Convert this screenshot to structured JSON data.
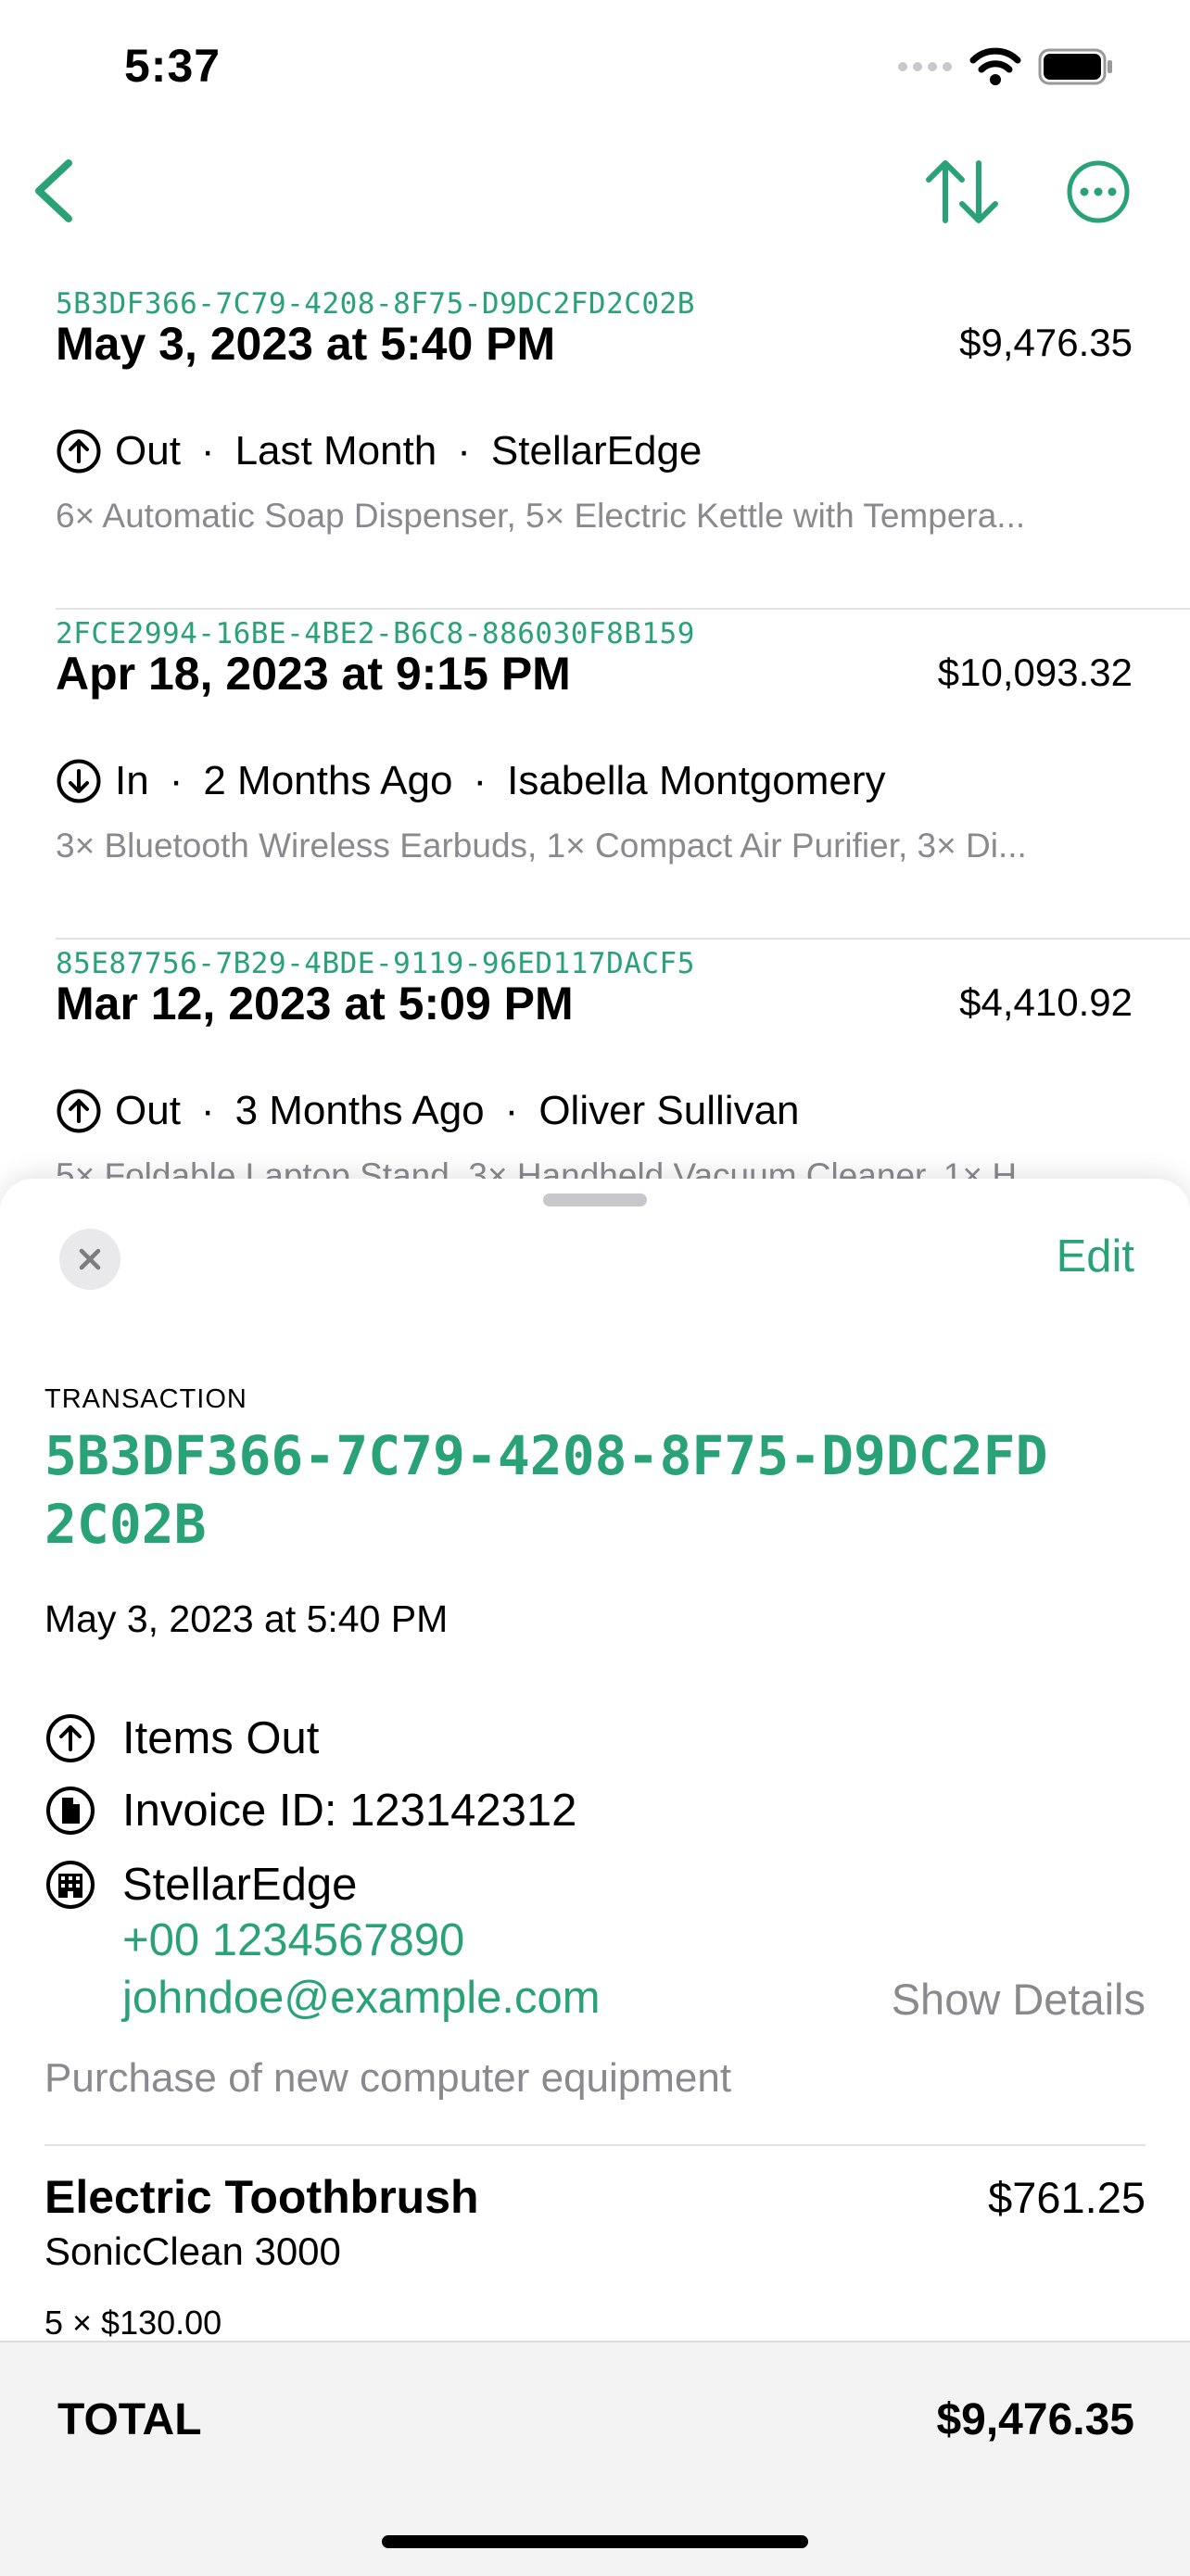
{
  "status_bar": {
    "time": "5:37"
  },
  "theme": {
    "accent": "#2aa277",
    "secondary_text": "#8a8a8e"
  },
  "nav": {
    "back_icon": "chevron-left-icon",
    "sort_icon": "arrow-up-down-icon",
    "more_icon": "ellipsis-circle-icon"
  },
  "transactions": [
    {
      "id": "5B3DF366-7C79-4208-8F75-D9DC2FD2C02B",
      "date": "May 3, 2023 at 5:40 PM",
      "amount": "$9,476.35",
      "direction": "Out",
      "direction_icon": "arrow-up-circle-icon",
      "relative": "Last Month",
      "party": "StellarEdge",
      "items": "6× Automatic Soap Dispenser, 5× Electric Kettle with Tempera..."
    },
    {
      "id": "2FCE2994-16BE-4BE2-B6C8-886030F8B159",
      "date": "Apr 18, 2023 at 9:15 PM",
      "amount": "$10,093.32",
      "direction": "In",
      "direction_icon": "arrow-down-circle-icon",
      "relative": "2 Months Ago",
      "party": "Isabella Montgomery",
      "items": "3× Bluetooth Wireless Earbuds, 1× Compact Air Purifier, 3× Di..."
    },
    {
      "id": "85E87756-7B29-4BDE-9119-96ED117DACF5",
      "date": "Mar 12, 2023 at 5:09 PM",
      "amount": "$4,410.92",
      "direction": "Out",
      "direction_icon": "arrow-up-circle-icon",
      "relative": "3 Months Ago",
      "party": "Oliver Sullivan",
      "items": "5× Foldable Laptop Stand, 3× Handheld Vacuum Cleaner, 1× H..."
    }
  ],
  "sheet": {
    "edit_label": "Edit",
    "section_label": "TRANSACTION",
    "transaction_id": "5B3DF366-7C79-4208-8F75-D9DC2FD2C02B",
    "date": "May 3, 2023 at 5:40 PM",
    "direction_label": "Items Out",
    "invoice": "Invoice ID: 123142312",
    "party": "StellarEdge",
    "phone": "+00 1234567890",
    "email": "johndoe@example.com",
    "show_details": "Show Details",
    "description": "Purchase of new computer equipment",
    "line_items": [
      {
        "name": "Electric Toothbrush",
        "model": "SonicClean 3000",
        "price": "$761.25",
        "qty_line": "5 × $130.00"
      }
    ],
    "total_label": "TOTAL",
    "total_value": "$9,476.35"
  }
}
